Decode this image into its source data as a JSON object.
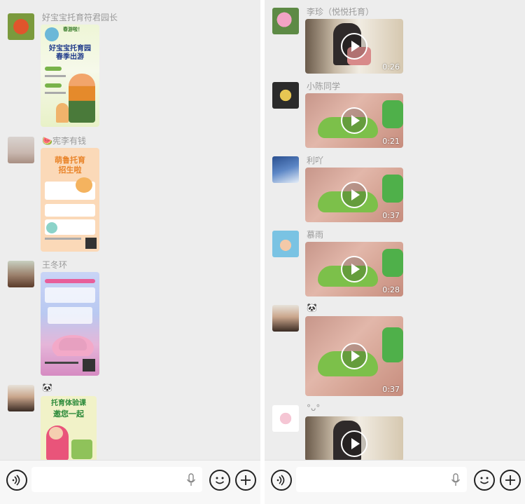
{
  "left_panel": {
    "messages": [
      {
        "sender": "好宝宝托育符君园长",
        "poster_heading": "好宝宝托育园",
        "poster_subheading": "春季出游",
        "poster_top": "春游啦！"
      },
      {
        "sender": "🍉宪李有钱",
        "poster_heading": "萌鲁托育",
        "poster_subheading": "招生啦"
      },
      {
        "sender": "王冬环",
        "poster_heading": ""
      },
      {
        "sender": "🐼",
        "poster_heading": "托育体验课",
        "poster_subheading": "邀您一起"
      }
    ]
  },
  "right_panel": {
    "messages": [
      {
        "sender": "李珍（悦悦托育）",
        "duration": "0:26"
      },
      {
        "sender": "小陈同学",
        "duration": "0:21"
      },
      {
        "sender": "利吖",
        "duration": "0:37"
      },
      {
        "sender": "慕雨",
        "duration": "0:28"
      },
      {
        "sender": "🐼",
        "duration": "0:37"
      },
      {
        "sender": "°ᴗ°",
        "duration": ""
      }
    ]
  },
  "icons": {
    "voice": "voice-icon",
    "mic": "microphone-icon",
    "emoji": "emoji-icon",
    "plus": "plus-icon",
    "play": "play-icon"
  },
  "colors": {
    "background": "#ededed",
    "input_bar": "#f7f7f7",
    "sender_text": "#9a9a9a"
  }
}
